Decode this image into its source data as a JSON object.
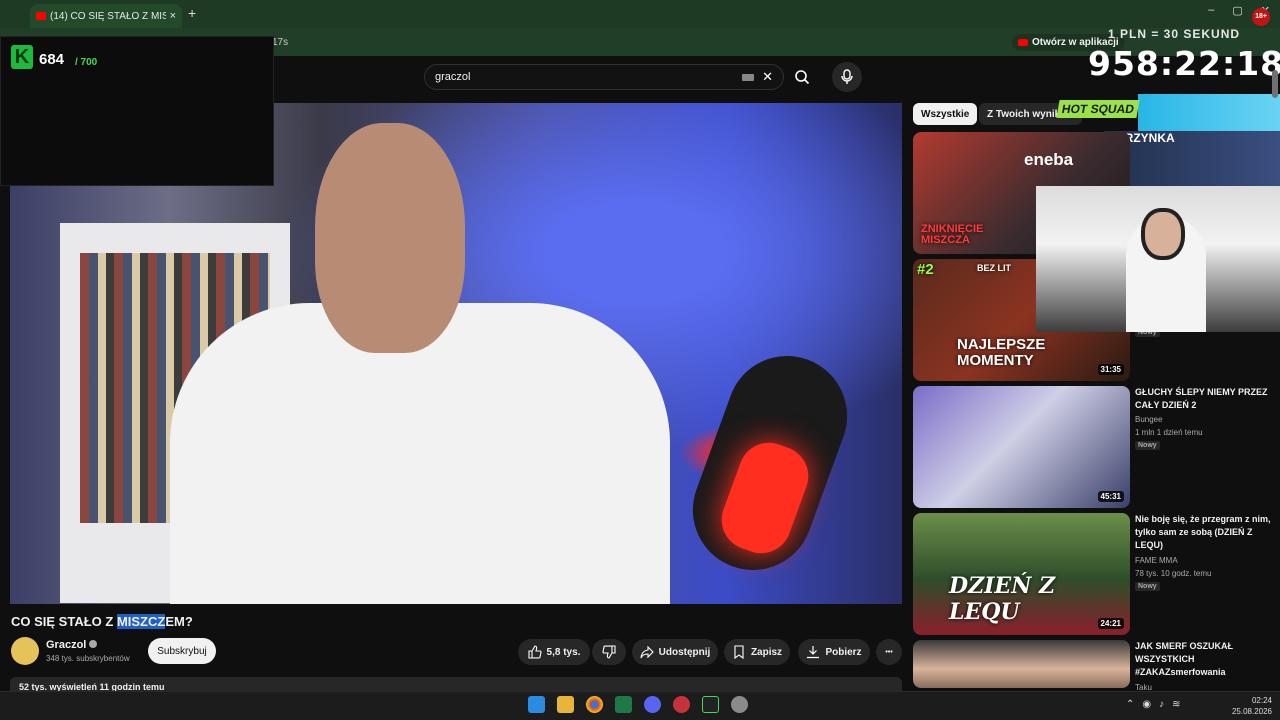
{
  "browser": {
    "tab_title": "(14) CO SIĘ STAŁO Z MISZ...",
    "tab_close": "×",
    "new_tab": "+",
    "address_fragment": "17s",
    "open_in_app": "Otwórz w aplikacji",
    "window_controls": [
      "–",
      "▢",
      "✕"
    ]
  },
  "overlay": {
    "logo_letter": "K",
    "sub_count": "684",
    "sub_goal": "/ 700",
    "pln_label": "1 PLN = 30 SEKUND",
    "timer": "958:22:18",
    "age_badge": "18+"
  },
  "search": {
    "value": "graczol",
    "clear": "✕"
  },
  "video": {
    "title_before": "CO SIĘ STAŁO Z ",
    "title_highlight": "MISZCZ",
    "title_after": "EM?",
    "channel_name": "Graczol",
    "channel_subs": "348 tys. subskrybentów",
    "subscribe_label": "Subskrybuj",
    "likes": "5,8 tys.",
    "share_label": "Udostępnij",
    "save_label": "Zapisz",
    "download_label": "Pobierz",
    "more_label": "•••",
    "views_line": "52 tys. wyświetleń  11 godzin temu"
  },
  "chips": {
    "all": "Wszystkie",
    "yours": "Z Twoich wyników"
  },
  "promo": {
    "eneba": "eneba",
    "hot_squad": "HOT SQUAD",
    "skrzynka": "SKRZYNKA"
  },
  "recommendations": [
    {
      "thumb_text": "ZNIKNIĘCIE MISZCZA",
      "title": "",
      "meta": "",
      "duration": ""
    },
    {
      "thumb_text": "NAJLEPSZE MOMENTY",
      "rank": "#2",
      "tag": "BEZ LIT",
      "title": "",
      "badge": "Nowy",
      "duration": "31:35"
    },
    {
      "title": "GŁUCHY ŚLEPY NIEMY PRZEZ CAŁY DZIEŃ 2",
      "channel": "Bungee",
      "meta": "1 mln  1 dzień temu",
      "badge": "Nowy",
      "duration": "45:31"
    },
    {
      "thumb_text": "DZIEŃ Z LEQU",
      "title": "Nie boję się, że przegram z nim, tylko sam ze sobą (DZIEŃ Z LEQU)",
      "channel": "FAME MMA",
      "meta": "78 tys.  10 godz. temu",
      "badge": "Nowy",
      "duration": "24:21"
    },
    {
      "title": "JAK SMERF OSZUKAŁ WSZYSTKICH #ZAKAZsmerfowania",
      "channel": "Taku"
    }
  ],
  "taskbar": {
    "time": "02:24",
    "date": "25.08.2026",
    "icons": [
      "windows-icon",
      "folder-icon",
      "chrome-icon",
      "excel-icon",
      "discord-icon",
      "app-icon",
      "xbox-icon",
      "settings-icon"
    ]
  },
  "colors": {
    "accent_red": "#ff0000",
    "chrome_green": "#1e3a24",
    "yt_bg": "#0f0f0f"
  }
}
